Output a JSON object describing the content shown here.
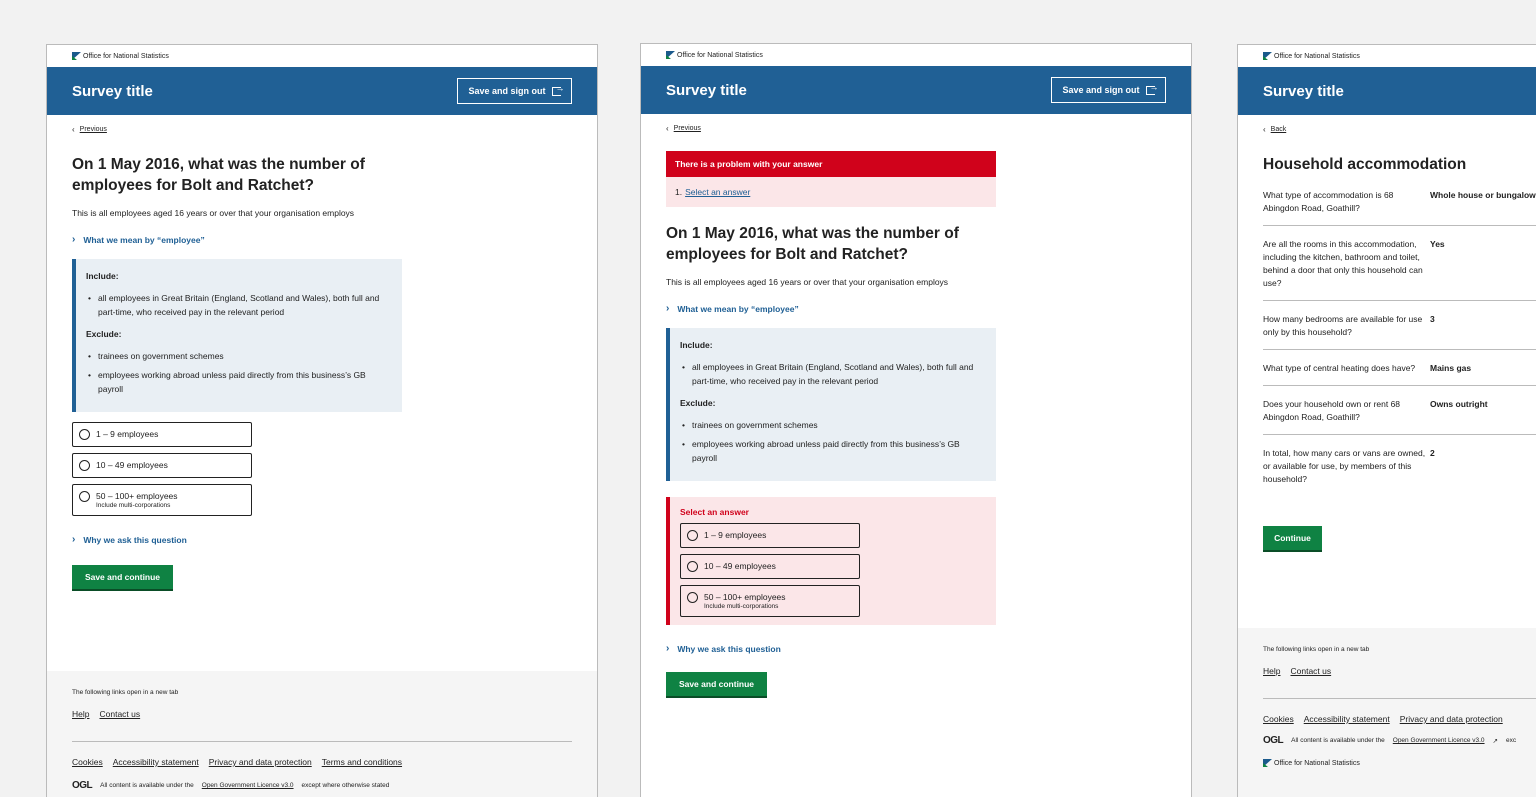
{
  "brand": {
    "org_name": "Office for National Statistics"
  },
  "header": {
    "title": "Survey title",
    "signout_label": "Save and sign out"
  },
  "question": {
    "previous_label": "Previous",
    "title": "On 1 May 2016, what was the number of employees for Bolt and Ratchet?",
    "hint": "This is all employees aged 16 years or over that your organisation employs",
    "details_label": "What we mean by “employee”",
    "include_heading": "Include:",
    "include_items": [
      "all employees in Great Britain (England, Scotland and Wales), both full and part-time, who received pay in the relevant period"
    ],
    "exclude_heading": "Exclude:",
    "exclude_items": [
      "trainees on government schemes",
      "employees working abroad unless paid directly from this business’s GB payroll"
    ],
    "options": [
      {
        "label": "1 – 9 employees",
        "sub": ""
      },
      {
        "label": "10 – 49 employees",
        "sub": ""
      },
      {
        "label": "50 – 100+ employees",
        "sub": "Include multi-corporations"
      }
    ],
    "why_label": "Why we ask this question",
    "submit_label": "Save and continue"
  },
  "error": {
    "title": "There is a problem with your answer",
    "item_number": "1.",
    "item_link": "Select an answer",
    "field_error": "Select an answer"
  },
  "summary": {
    "back_label": "Back",
    "title": "Household accommodation",
    "rows": [
      {
        "q": "What type of accommodation is 68 Abingdon Road, Goathill?",
        "a": "Whole house or bungalow"
      },
      {
        "q": "Are all the rooms in this accommodation, including the kitchen, bathroom and toilet, behind a door that only this household can use?",
        "a": "Yes"
      },
      {
        "q": "How many bedrooms are available for use only by this household?",
        "a": "3"
      },
      {
        "q": "What type of central heating does have?",
        "a": "Mains gas"
      },
      {
        "q": "Does your household own or rent 68 Abingdon Road, Goathill?",
        "a": "Owns outright"
      },
      {
        "q": "In total, how many cars or vans are owned, or available for use, by members of this household?",
        "a": "2"
      }
    ],
    "continue_label": "Continue"
  },
  "footer": {
    "new_tab_note": "The following links open in a new tab",
    "help": "Help",
    "contact": "Contact us",
    "cookies": "Cookies",
    "accessibility": "Accessibility statement",
    "privacy": "Privacy and data protection",
    "terms": "Terms and conditions",
    "ogl_mark": "OGL",
    "licence_prefix": "All content is available under the",
    "licence_link": "Open Government Licence v3.0",
    "licence_suffix": "except where otherwise stated",
    "licence_suffix_short": "exc"
  }
}
